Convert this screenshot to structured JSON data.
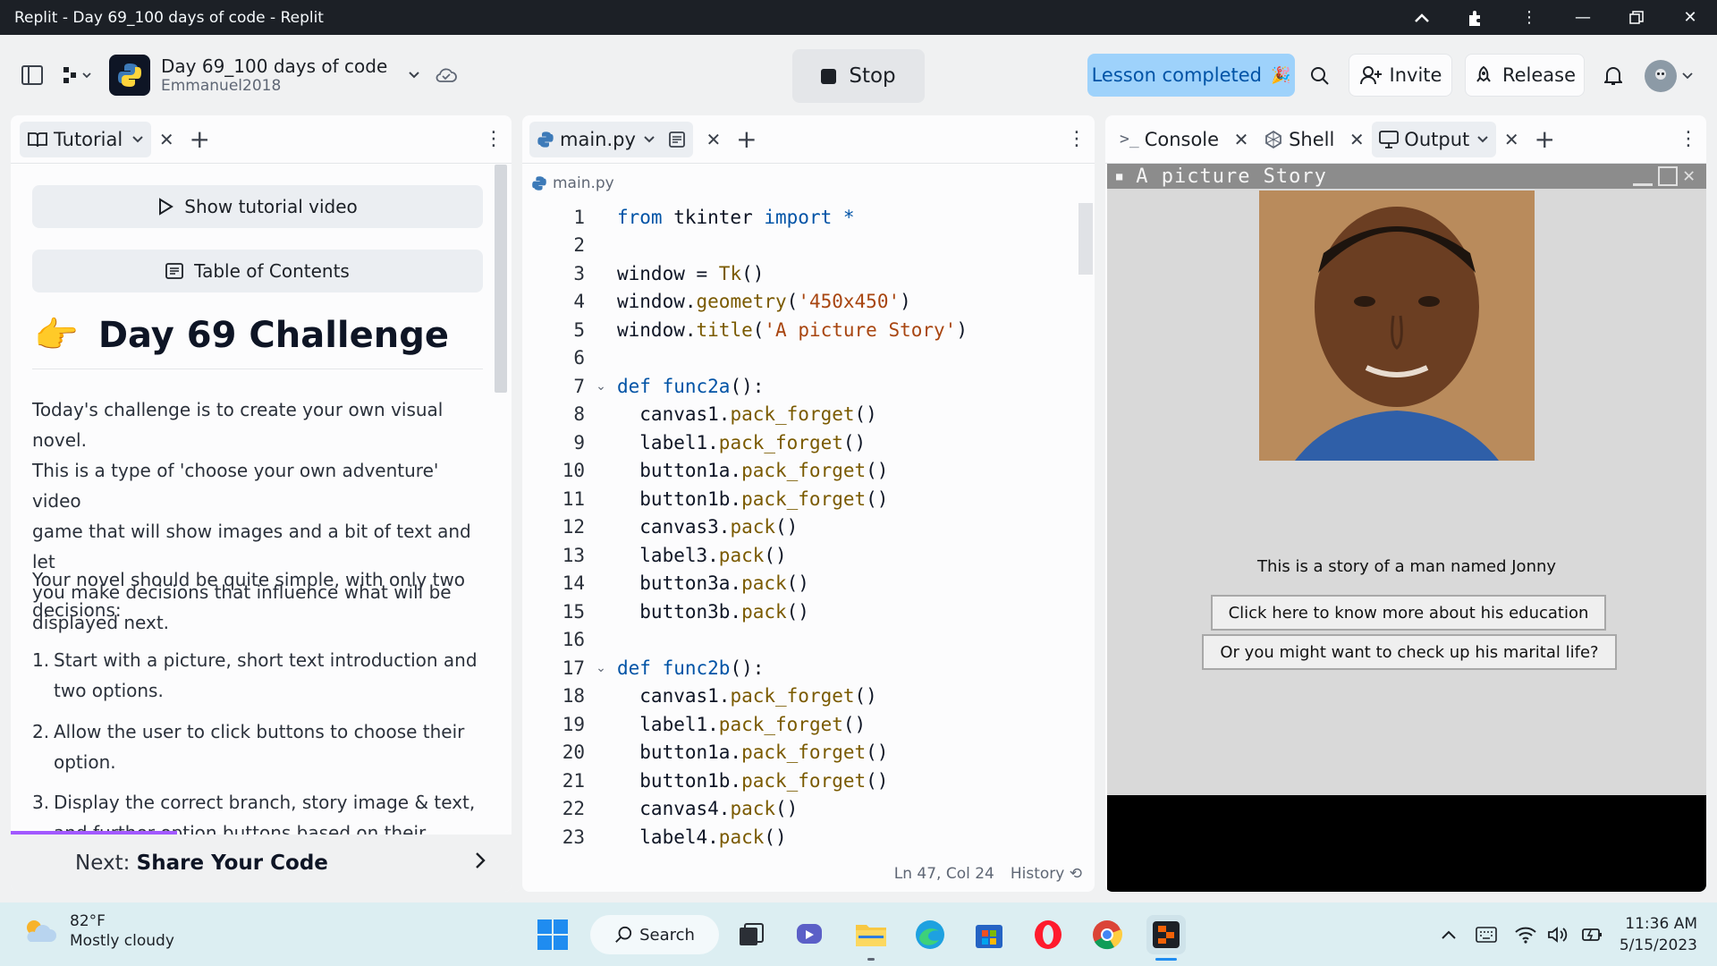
{
  "window": {
    "title": "Replit - Day 69_100 days of code - Replit"
  },
  "header": {
    "repl_name": "Day 69_100 days of code",
    "owner": "Emmanuel2018",
    "stop_label": "Stop",
    "lesson_label": "Lesson completed",
    "invite_label": "Invite",
    "release_label": "Release"
  },
  "tutorial": {
    "tab_label": "Tutorial",
    "show_video": "Show tutorial video",
    "toc": "Table of Contents",
    "heading_emoji": "👉",
    "heading": "Day 69 Challenge",
    "para1_lines": [
      "Today's challenge is to create your own visual novel.",
      "This is a type of 'choose your own adventure' video",
      "game that will show images and a bit of text and let",
      "you make decisions that influence what will be",
      "displayed next."
    ],
    "para2_lines": [
      "Your novel should be quite simple, with only two",
      "decisions:"
    ],
    "list": [
      {
        "num": "1.",
        "lines": [
          "Start with a picture, short text introduction and",
          "two options."
        ]
      },
      {
        "num": "2.",
        "lines": [
          "Allow the user to click buttons to choose their",
          "option."
        ]
      },
      {
        "num": "3.",
        "lines": [
          "Display the correct branch, story image & text,",
          "and further option buttons based on their choice."
        ]
      }
    ],
    "next_prefix": "Next:",
    "next_title": "Share Your Code"
  },
  "editor": {
    "tab_label": "main.py",
    "crumb": "main.py",
    "status_pos": "Ln 47, Col 24",
    "status_history": "History",
    "lines": [
      {
        "n": "1",
        "fold": "",
        "html": "<span class='kw'>from</span> tkinter <span class='kw'>import</span> <span class='kw'>*</span>"
      },
      {
        "n": "2",
        "fold": "",
        "html": ""
      },
      {
        "n": "3",
        "fold": "",
        "html": "window = <span class='fn'>Tk</span>()"
      },
      {
        "n": "4",
        "fold": "",
        "html": "window.<span class='fn'>geometry</span>(<span class='str'>'450x450'</span>)"
      },
      {
        "n": "5",
        "fold": "",
        "html": "window.<span class='fn'>title</span>(<span class='str'>'A picture Story'</span>)"
      },
      {
        "n": "6",
        "fold": "",
        "html": ""
      },
      {
        "n": "7",
        "fold": "⌄",
        "html": "<span class='kw'>def</span> <span class='kw'>func2a</span>():"
      },
      {
        "n": "8",
        "fold": "",
        "html": "  canvas1.<span class='fn'>pack_forget</span>()"
      },
      {
        "n": "9",
        "fold": "",
        "html": "  label1.<span class='fn'>pack_forget</span>()"
      },
      {
        "n": "10",
        "fold": "",
        "html": "  button1a.<span class='fn'>pack_forget</span>()"
      },
      {
        "n": "11",
        "fold": "",
        "html": "  button1b.<span class='fn'>pack_forget</span>()"
      },
      {
        "n": "12",
        "fold": "",
        "html": "  canvas3.<span class='fn'>pack</span>()"
      },
      {
        "n": "13",
        "fold": "",
        "html": "  label3.<span class='fn'>pack</span>()"
      },
      {
        "n": "14",
        "fold": "",
        "html": "  button3a.<span class='fn'>pack</span>()"
      },
      {
        "n": "15",
        "fold": "",
        "html": "  button3b.<span class='fn'>pack</span>()"
      },
      {
        "n": "16",
        "fold": "",
        "html": ""
      },
      {
        "n": "17",
        "fold": "⌄",
        "html": "<span class='kw'>def</span> <span class='kw'>func2b</span>():"
      },
      {
        "n": "18",
        "fold": "",
        "html": "  canvas1.<span class='fn'>pack_forget</span>()"
      },
      {
        "n": "19",
        "fold": "",
        "html": "  label1.<span class='fn'>pack_forget</span>()"
      },
      {
        "n": "20",
        "fold": "",
        "html": "  button1a.<span class='fn'>pack_forget</span>()"
      },
      {
        "n": "21",
        "fold": "",
        "html": "  button1b.<span class='fn'>pack_forget</span>()"
      },
      {
        "n": "22",
        "fold": "",
        "html": "  canvas4.<span class='fn'>pack</span>()"
      },
      {
        "n": "23",
        "fold": "",
        "html": "  label4.<span class='fn'>pack</span>()"
      }
    ]
  },
  "output": {
    "tabs": {
      "console": "Console",
      "shell": "Shell",
      "output": "Output"
    },
    "tk_title": "A picture Story",
    "tk_label": "This is a story of a man named Jonny",
    "tk_btn1": "Click here to know more about his education",
    "tk_btn2": "Or you might want to check up his marital life?"
  },
  "taskbar": {
    "temp": "82°F",
    "weather": "Mostly cloudy",
    "search": "Search",
    "time": "11:36 AM",
    "date": "5/15/2023"
  },
  "colors": {
    "accent": "#a259ff",
    "lesson_bg": "#9ed2fb",
    "python_blue": "#3572a5"
  }
}
